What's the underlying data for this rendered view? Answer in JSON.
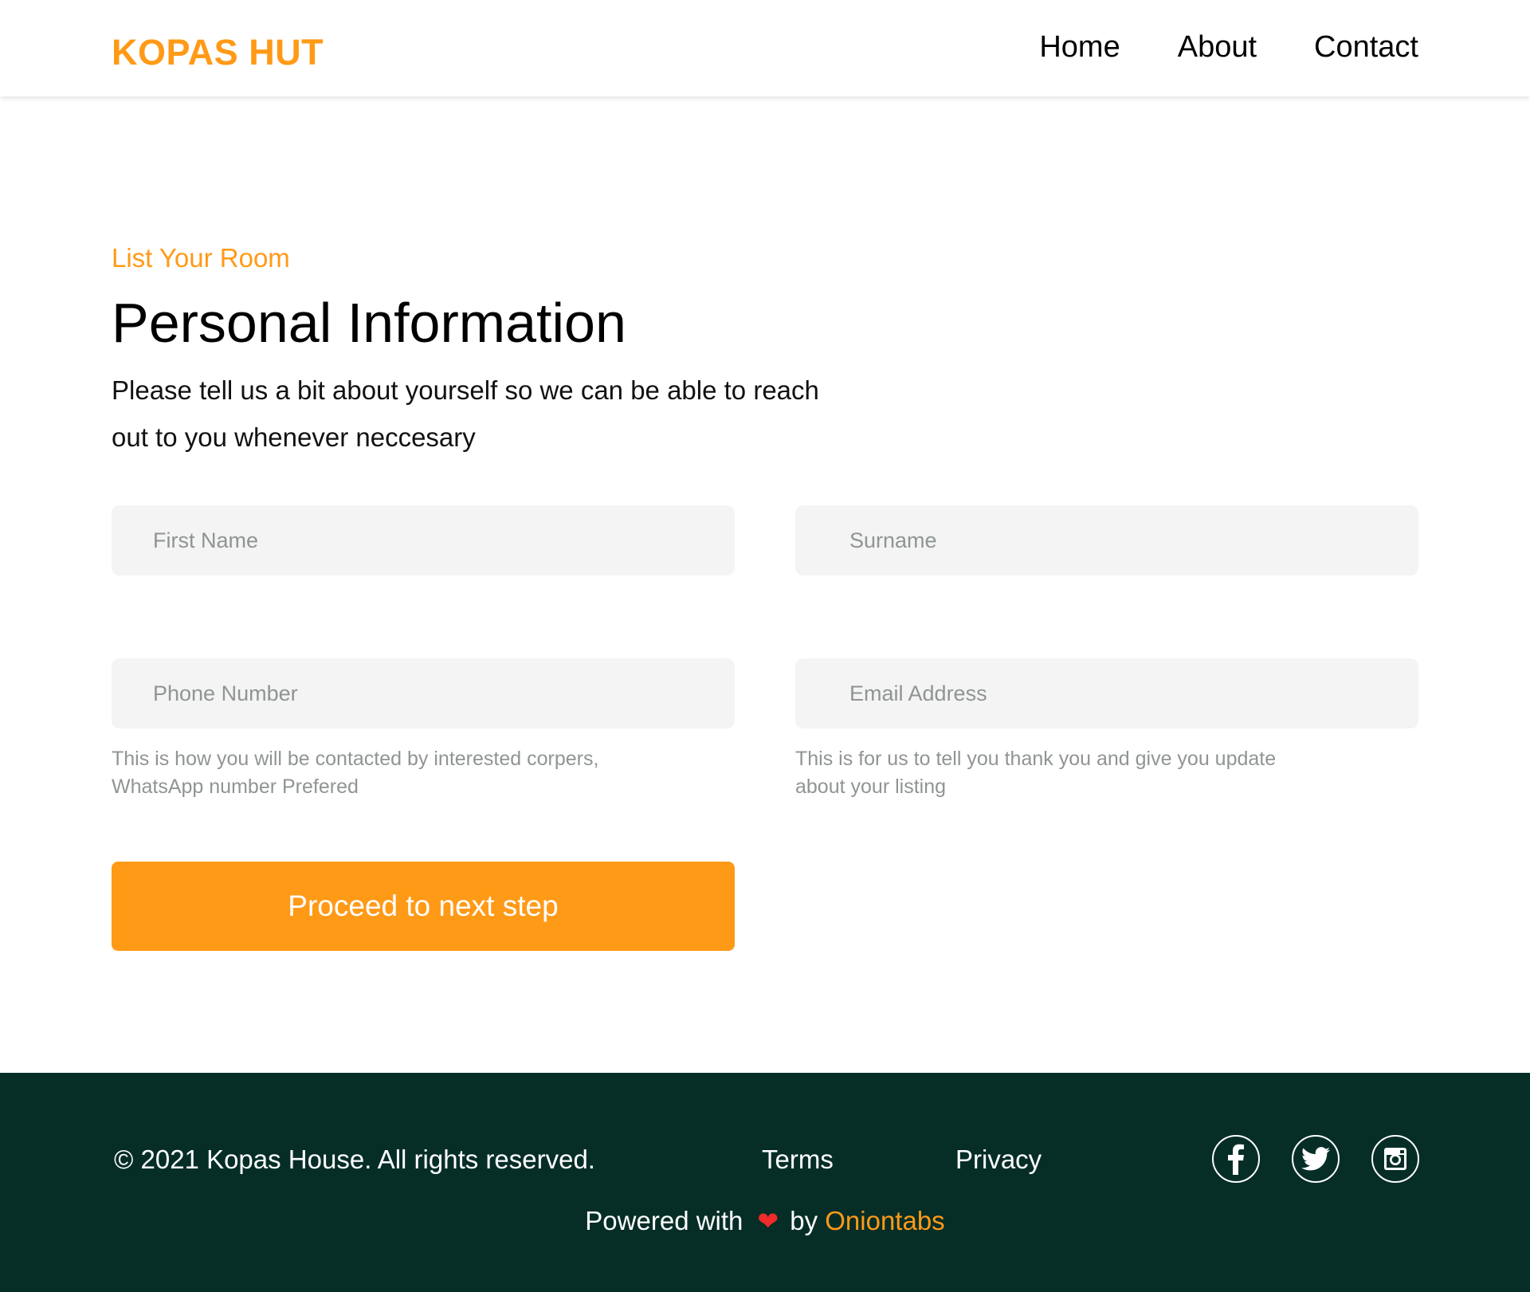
{
  "header": {
    "logo": "KOPAS HUT",
    "nav": [
      {
        "label": "Home"
      },
      {
        "label": "About"
      },
      {
        "label": "Contact"
      }
    ]
  },
  "main": {
    "eyebrow": "List Your Room",
    "title": "Personal Information",
    "intro_line1": "Please tell us a bit about yourself so we can be able to reach",
    "intro_line2": "out to you whenever neccesary",
    "fields": {
      "first_name": {
        "placeholder": "First Name",
        "value": ""
      },
      "surname": {
        "placeholder": "Surname",
        "value": ""
      },
      "phone": {
        "placeholder": "Phone Number",
        "value": ""
      },
      "email": {
        "placeholder": "Email Address",
        "value": ""
      }
    },
    "phone_hint_line1": "This is how you will be contacted by interested corpers,",
    "phone_hint_line2": "WhatsApp number Prefered",
    "email_hint_line1": "This is for us to tell you thank you and give you update",
    "email_hint_line2": "about your listing",
    "proceed_label": "Proceed to next step"
  },
  "footer": {
    "copyright": "© 2021 Kopas House. All rights reserved.",
    "terms": "Terms",
    "privacy": "Privacy",
    "social": [
      "facebook-icon",
      "twitter-icon",
      "instagram-icon"
    ],
    "powered_prefix": "Powered with",
    "heart": "❤",
    "powered_by": "by",
    "powered_brand": "Oniontabs"
  },
  "colors": {
    "accent": "#FF9A17",
    "footer_bg": "#062E27",
    "field_bg": "#F3F4F3",
    "hint_text": "#8F9592",
    "heart": "#F12A2A"
  }
}
